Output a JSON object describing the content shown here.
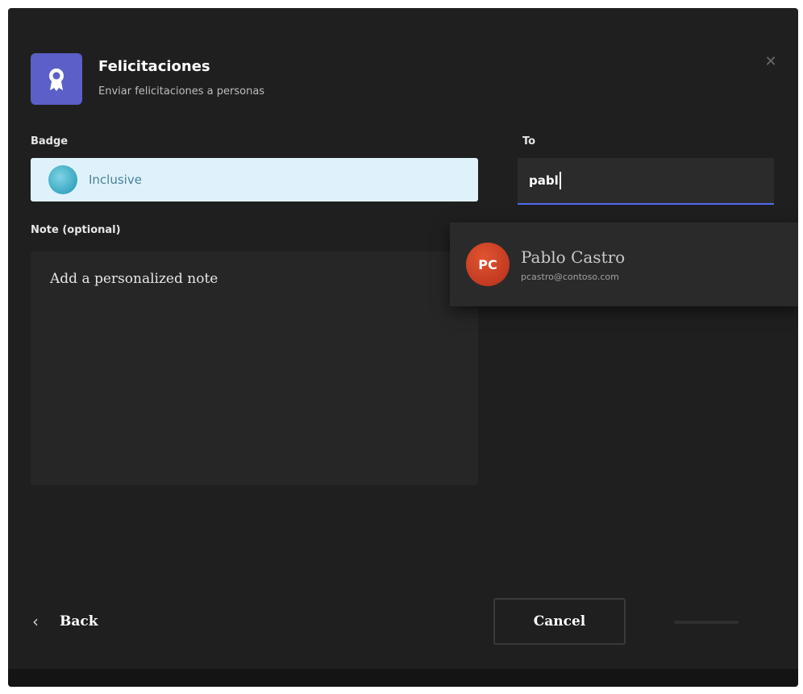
{
  "header": {
    "title": "Felicitaciones",
    "subtitle": "Enviar felicitaciones a personas"
  },
  "badge": {
    "label": "Badge",
    "selected_value": "Inclusive"
  },
  "to": {
    "label": "To",
    "value": "pabl"
  },
  "suggestion": {
    "initials": "PC",
    "name": "Pablo Castro",
    "email": "pcastro@contoso.com"
  },
  "note": {
    "label": "Note (optional)",
    "placeholder": "Add a personalized note"
  },
  "footer": {
    "back_label": "Back",
    "cancel_label": "Cancel"
  },
  "colors": {
    "dialog_bg": "#1f1f1f",
    "app_icon_bg": "#5b5fc7",
    "badge_select_bg": "#dff2fb",
    "avatar_bg": "#c23a22",
    "input_focus_border": "#4f6bed"
  }
}
